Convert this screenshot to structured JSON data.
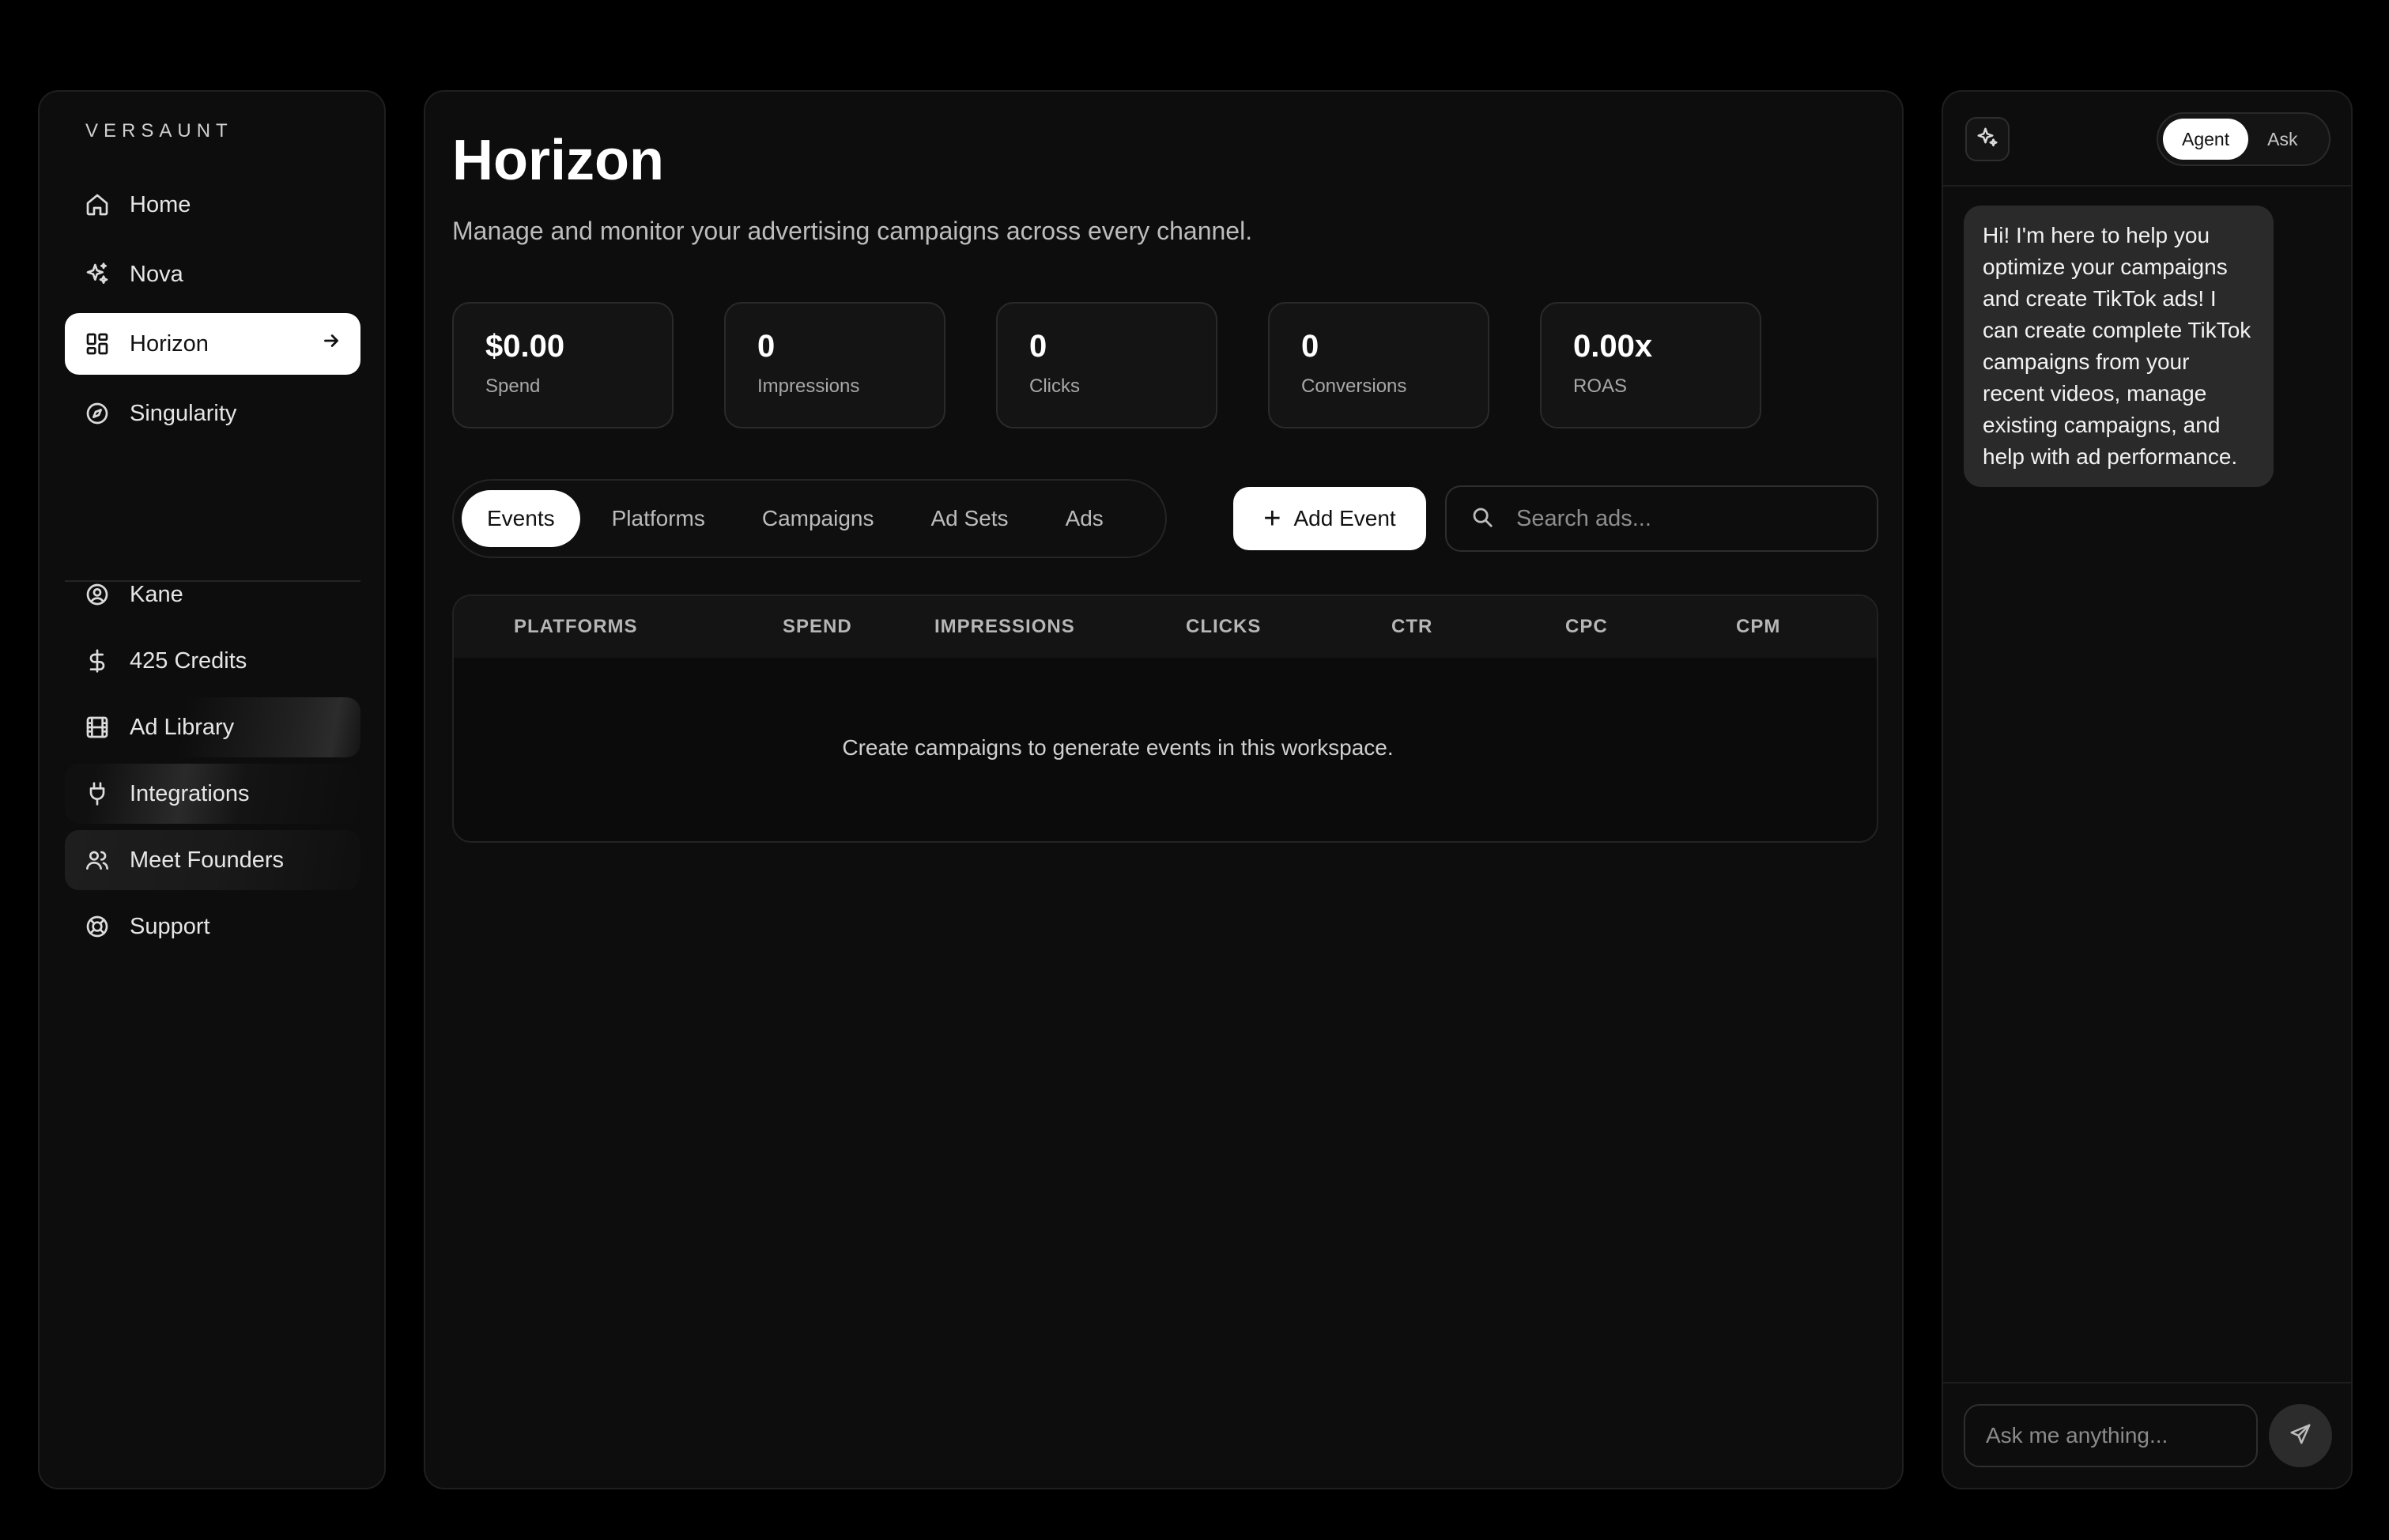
{
  "brand": "VERSAUNT",
  "sidebar": {
    "top_items": [
      {
        "label": "Home",
        "icon": "home-icon"
      },
      {
        "label": "Nova",
        "icon": "sparkles-icon"
      },
      {
        "label": "Horizon",
        "icon": "dashboard-grid-icon",
        "active": true
      },
      {
        "label": "Singularity",
        "icon": "compass-icon"
      }
    ],
    "bottom_items": [
      {
        "label": "Kane",
        "icon": "user-circle-icon"
      },
      {
        "label": "425 Credits",
        "icon": "dollar-icon"
      },
      {
        "label": "Ad Library",
        "icon": "film-icon"
      },
      {
        "label": "Integrations",
        "icon": "plug-icon"
      },
      {
        "label": "Meet Founders",
        "icon": "users-icon"
      },
      {
        "label": "Support",
        "icon": "lifebuoy-icon"
      }
    ]
  },
  "main": {
    "title": "Horizon",
    "subtitle": "Manage and monitor your advertising campaigns across every channel.",
    "stats": [
      {
        "value": "$0.00",
        "label": "Spend"
      },
      {
        "value": "0",
        "label": "Impressions"
      },
      {
        "value": "0",
        "label": "Clicks"
      },
      {
        "value": "0",
        "label": "Conversions"
      },
      {
        "value": "0.00x",
        "label": "ROAS"
      }
    ],
    "tabs": [
      "Events",
      "Platforms",
      "Campaigns",
      "Ad Sets",
      "Ads"
    ],
    "active_tab": "Events",
    "add_button": "Add Event",
    "search_placeholder": "Search ads...",
    "table": {
      "columns": [
        "PLATFORMS",
        "SPEND",
        "IMPRESSIONS",
        "CLICKS",
        "CTR",
        "CPC",
        "CPM"
      ],
      "empty_message": "Create campaigns to generate events in this workspace."
    }
  },
  "chat": {
    "modes": [
      "Agent",
      "Ask"
    ],
    "active_mode": "Agent",
    "message": "Hi! I'm here to help you optimize your campaigns and create TikTok ads! I can create complete TikTok campaigns from your recent videos, manage existing campaigns, and help with ad performance.",
    "input_placeholder": "Ask me anything..."
  },
  "colors": {
    "background": "#000000",
    "panel": "#0d0d0d",
    "accent": "#ffffff",
    "bubble": "#2a2a2a"
  }
}
